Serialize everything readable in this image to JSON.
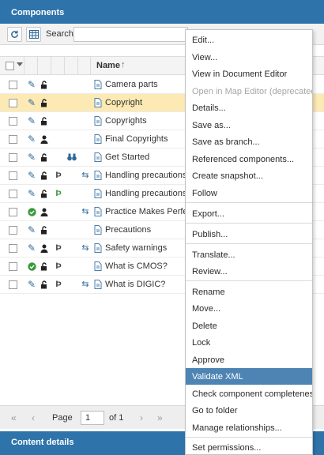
{
  "panel": {
    "title": "Components"
  },
  "toolbar": {
    "search_label": "Search:",
    "search_value": ""
  },
  "grid": {
    "column_name": "Name",
    "sort_icon": "arrow-up-icon"
  },
  "rows": [
    {
      "name": "Camera parts",
      "icons": [
        "pencil-icon",
        "unlock-icon",
        "doc-icon"
      ]
    },
    {
      "name": "Copyright",
      "selected": true,
      "icons": [
        "pencil-icon",
        "unlock-icon",
        "doc-icon"
      ]
    },
    {
      "name": "Copyrights",
      "icons": [
        "pencil-icon",
        "unlock-icon",
        "doc-icon"
      ]
    },
    {
      "name": "Final Copyrights",
      "icons": [
        "pencil-icon",
        "person-icon",
        "doc-icon"
      ]
    },
    {
      "name": "Get Started",
      "icons": [
        "pencil-icon",
        "unlock-icon",
        "binoculars-icon",
        "doc-icon"
      ]
    },
    {
      "name": "Handling precautions",
      "icons": [
        "pencil-icon",
        "unlock-icon",
        "flag-icon",
        "sync-icon",
        "doc-icon"
      ]
    },
    {
      "name": "Handling precautions_F",
      "icons": [
        "pencil-icon",
        "unlock-icon",
        "flag-green-icon",
        "doc-icon"
      ]
    },
    {
      "name": "Practice Makes Perfect",
      "icons": [
        "check-circle-icon",
        "person-icon",
        "sync-icon",
        "doc-icon"
      ]
    },
    {
      "name": "Precautions",
      "icons": [
        "pencil-icon",
        "unlock-icon",
        "doc-icon"
      ]
    },
    {
      "name": "Safety warnings",
      "icons": [
        "pencil-icon",
        "person-icon",
        "flag-icon",
        "sync-icon",
        "doc-icon"
      ]
    },
    {
      "name": "What is CMOS?",
      "icons": [
        "check-circle-icon",
        "unlock-icon",
        "flag-icon",
        "doc-icon"
      ]
    },
    {
      "name": "What is DIGIC?",
      "icons": [
        "pencil-icon",
        "unlock-icon",
        "flag-icon",
        "sync-icon",
        "doc-icon"
      ]
    }
  ],
  "pager": {
    "page_label": "Page",
    "page_value": "1",
    "of_label": "of 1"
  },
  "footer": {
    "title": "Content details"
  },
  "context_menu": {
    "items": [
      "Edit...",
      "View...",
      "View in Document Editor",
      "Open in Map Editor (deprecated)",
      "Details...",
      "Save as...",
      "Save as branch...",
      "Referenced components...",
      "Create snapshot...",
      "Follow",
      "Export...",
      "Publish...",
      "Translate...",
      "Review...",
      "Rename",
      "Move...",
      "Delete",
      "Lock",
      "Approve",
      "Validate XML",
      "Check component completeness",
      "Go to folder",
      "Manage relationships...",
      "Set permissions..."
    ],
    "disabled_item": "Open in Map Editor (deprecated)",
    "highlighted_item": "Validate XML"
  },
  "colors": {
    "header": "#2e74ab",
    "selected_row": "#fde9b3",
    "menu_highlight": "#4d84b3"
  }
}
